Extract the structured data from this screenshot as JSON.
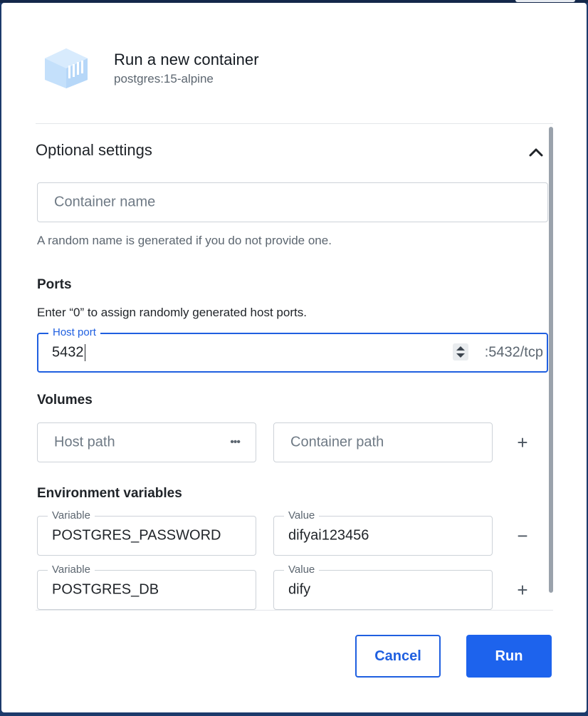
{
  "dialog": {
    "title": "Run a new container",
    "image": "postgres:15-alpine",
    "logo_icon": "container-icon"
  },
  "optional_settings": {
    "title": "Optional settings",
    "expanded": true,
    "container_name": {
      "placeholder": "Container name",
      "value": "",
      "helper": "A random name is generated if you do not provide one."
    },
    "ports": {
      "title": "Ports",
      "description": "Enter “0” to assign randomly generated host ports.",
      "host_port_label": "Host port",
      "host_port_value": "5432",
      "container_port": ":5432/tcp"
    },
    "volumes": {
      "title": "Volumes",
      "host_path_placeholder": "Host path",
      "browse_label": "•••",
      "container_path_placeholder": "Container path",
      "add_label": "+"
    },
    "env": {
      "title": "Environment variables",
      "variable_label": "Variable",
      "value_label": "Value",
      "rows": [
        {
          "variable": "POSTGRES_PASSWORD",
          "value": "difyai123456",
          "action": "−"
        },
        {
          "variable": "POSTGRES_DB",
          "value": "dify",
          "action": "+"
        }
      ]
    }
  },
  "footer": {
    "cancel_label": "Cancel",
    "run_label": "Run"
  },
  "colors": {
    "accent": "#1d63ed",
    "logo": "#c4e0fb"
  }
}
